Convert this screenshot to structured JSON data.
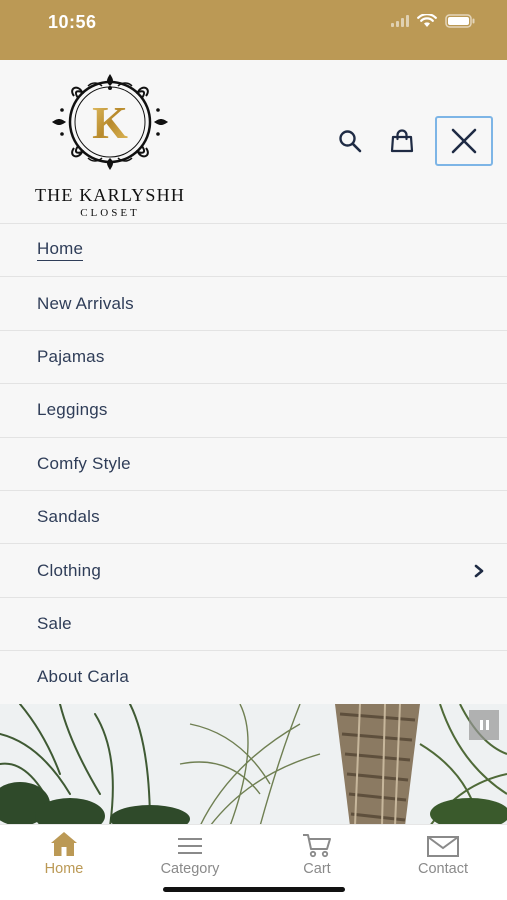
{
  "status_bar": {
    "time": "10:56"
  },
  "brand": {
    "name": "THE KARLYSHH",
    "sub": "CLOSET",
    "monogram": "K"
  },
  "header_icons": [
    "search-icon",
    "shopping-bag-icon",
    "close-icon"
  ],
  "menu": {
    "items": [
      {
        "label": "Home",
        "active": true
      },
      {
        "label": "New Arrivals"
      },
      {
        "label": "Pajamas"
      },
      {
        "label": "Leggings"
      },
      {
        "label": "Comfy Style"
      },
      {
        "label": "Sandals"
      },
      {
        "label": "Clothing",
        "has_submenu": true
      },
      {
        "label": "Sale"
      },
      {
        "label": "About Carla"
      }
    ]
  },
  "tabbar": {
    "tabs": [
      {
        "label": "Home",
        "icon": "home-icon",
        "active": true
      },
      {
        "label": "Category",
        "icon": "menu-icon"
      },
      {
        "label": "Cart",
        "icon": "cart-icon"
      },
      {
        "label": "Contact",
        "icon": "mail-icon"
      }
    ]
  },
  "colors": {
    "accent": "#bb9955",
    "menu_text": "#2f3d58",
    "focus_outline": "#7db5e6"
  }
}
